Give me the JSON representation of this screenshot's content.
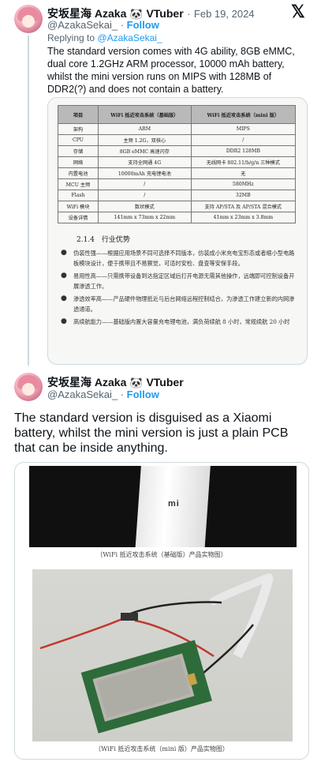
{
  "tweet1": {
    "display_name": "安坂星海 Azaka",
    "emoji": "🐼",
    "tag": "VTuber",
    "separator": "·",
    "date": "Feb 19, 2024",
    "handle": "@AzakaSekai_",
    "follow": "Follow",
    "replying_prefix": "Replying to",
    "replying_handle": "@AzakaSekai_",
    "text": "The standard version comes with 4G ability, 8GB eMMC, dual core 1.2GHz ARM processor, 10000 mAh battery, whilst the mini version runs on MIPS with 128MB of DDR2(?) and does not contain a battery."
  },
  "spec_doc": {
    "headers": [
      "项目",
      "WiFi 抵近攻击系统（基础版）",
      "WiFi 抵近攻击系统（mini 版）"
    ],
    "rows": [
      [
        "架构",
        "ARM",
        "MIPS"
      ],
      [
        "CPU",
        "主频 1.2G，双核心",
        "/"
      ],
      [
        "存储",
        "8GB eMMC 高速闪存",
        "DDR2 128MB"
      ],
      [
        "网络",
        "支持全网通 4G",
        "无线网卡 802.11/b/g/n 三种模式"
      ],
      [
        "内置电池",
        "10000mAh 充电锂电池",
        "无"
      ],
      [
        "MCU 主频",
        "/",
        "580MHz"
      ],
      [
        "Flash",
        "/",
        "32MB"
      ],
      [
        "WiFi 模块",
        "数状模式",
        "支持 AP/STA 及 AP/STA 混合模式"
      ],
      [
        "设备详情",
        "141mm x 73mm x 22mm",
        "41mm x 23mm x 3.8mm"
      ]
    ],
    "section": "2.1.4　行业优势",
    "bullets": [
      "伪装性强——根据应用场景不同可选择不同版本，仿装成小米充电宝形态或者缩小型电路板模块设计，便于携带且不易察觉，可适时安检、盘查等安保手段。",
      "易用性高——只需携带设备到达指定区域后打开电源无需其他操作，远端即可控制设备开展渗透工作。",
      "渗透效率高——产品硬件物理抵近与后台网络远程控制结合，为渗透工作建立新的内网渗透通道。",
      "高续航能力——基础版内置大容量充电锂电池，满负荷续航 8 小时，常规续航 20 小时"
    ]
  },
  "tweet2": {
    "display_name": "安坂星海 Azaka",
    "emoji": "🐼",
    "tag": "VTuber",
    "handle": "@AzakaSekai_",
    "separator": "·",
    "follow": "Follow",
    "text": "The standard version is disguised as a Xiaomi battery, whilst the mini version is just a plain PCB that can be inside anything."
  },
  "photos": {
    "device_logo": "mi",
    "caption1": "（WiFi 抵近攻击系统（基础版）产品实物图）",
    "caption2": "（WiFi 抵近攻击系统（mini 版）产品实物图）"
  },
  "icons": {
    "x_logo": "𝕏"
  }
}
